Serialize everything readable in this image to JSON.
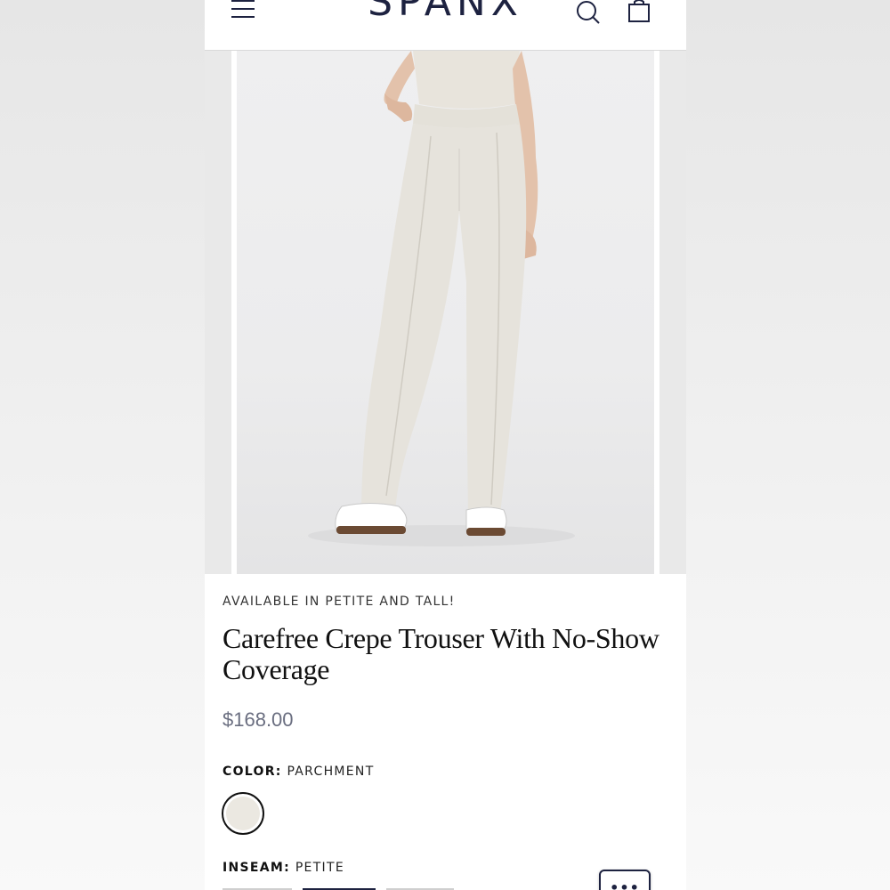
{
  "header": {
    "logo": "SPANX",
    "icons": [
      "menu-icon",
      "search-icon",
      "shopping-bag-icon"
    ]
  },
  "product": {
    "eyebrow": "AVAILABLE IN PETITE AND TALL!",
    "title": "Carefree Crepe Trouser With No-Show Coverage",
    "price": "$168.00",
    "color": {
      "label": "COLOR:",
      "value": "PARCHMENT",
      "swatch_hex": "#ebe8e1"
    },
    "inseam": {
      "label": "INSEAM:",
      "value": "PETITE"
    }
  },
  "chat": {
    "icon": "chat-ellipsis-icon",
    "dots": "•••"
  },
  "colors": {
    "brand_navy": "#1d2240",
    "price_gray": "#6a6e80",
    "background": "#ffffff"
  }
}
